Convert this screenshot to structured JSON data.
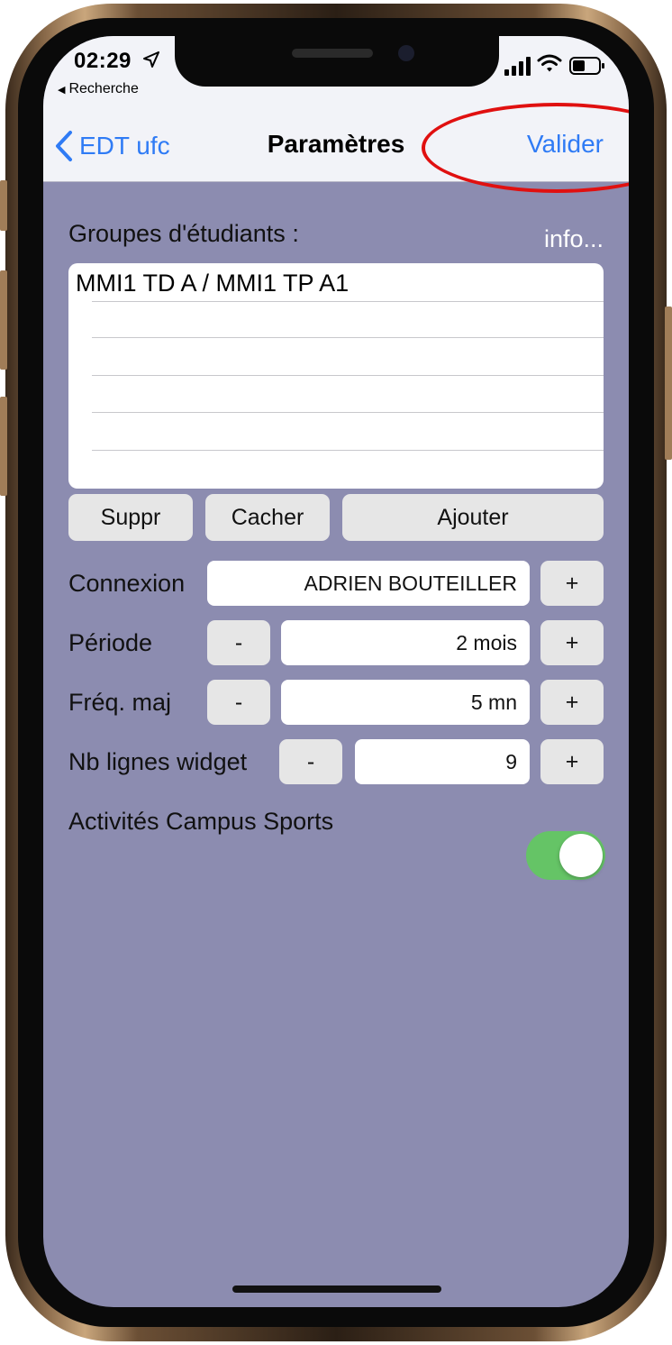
{
  "status_bar": {
    "time": "02:29",
    "back_app": "Recherche",
    "icons": [
      "location-arrow-icon",
      "cellular-signal-icon",
      "wifi-icon",
      "battery-icon"
    ]
  },
  "nav": {
    "back_label": "EDT ufc",
    "title": "Paramètres",
    "action_label": "Valider"
  },
  "groups": {
    "label": "Groupes d'étudiants :",
    "info_label": "info...",
    "items": [
      "MMI1 TD A / MMI1 TP A1",
      "",
      "",
      "",
      "",
      ""
    ]
  },
  "group_actions": {
    "delete_label": "Suppr",
    "hide_label": "Cacher",
    "add_label": "Ajouter"
  },
  "settings": {
    "connexion": {
      "label": "Connexion",
      "value": "ADRIEN BOUTEILLER",
      "plus": "+"
    },
    "periode": {
      "label": "Période",
      "minus": "-",
      "value": "2 mois",
      "plus": "+"
    },
    "freq": {
      "label": "Fréq. maj",
      "minus": "-",
      "value": "5 mn",
      "plus": "+"
    },
    "widget_lines": {
      "label": "Nb lignes widget",
      "minus": "-",
      "value": "9",
      "plus": "+"
    },
    "campus_sports": {
      "label": "Activités Campus Sports",
      "enabled": true
    }
  },
  "colors": {
    "background": "#8c8cb0",
    "accent": "#2f7bf5",
    "toggle_on": "#65c466",
    "highlight_ring": "#e01010"
  }
}
